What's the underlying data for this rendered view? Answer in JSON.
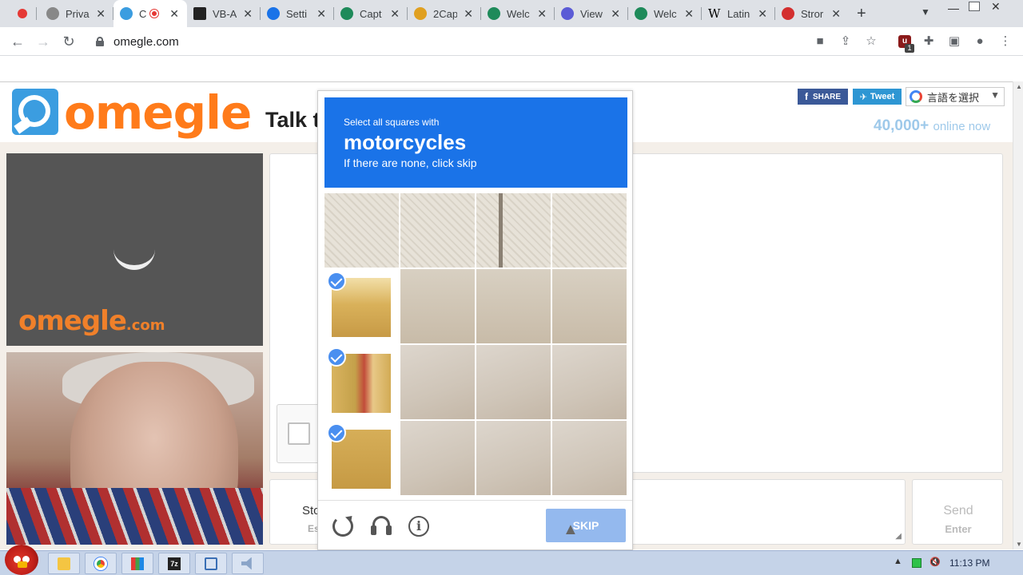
{
  "browser": {
    "tabs": [
      {
        "label": "",
        "icon": "record-icon",
        "color": "#e53935"
      },
      {
        "label": "Priva",
        "icon": "globe-icon",
        "color": "#5f6368"
      },
      {
        "label": "C",
        "icon": "omegle-favicon-icon",
        "color": "#3b9de0",
        "active": true
      },
      {
        "label": "VB-A",
        "icon": "vb-favicon-icon",
        "color": "#222222"
      },
      {
        "label": "Setti",
        "icon": "gear-icon",
        "color": "#1a73e8"
      },
      {
        "label": "Capt",
        "icon": "6-favicon-icon",
        "color": "#1e8a5a"
      },
      {
        "label": "2Cap",
        "icon": "2captcha-favicon-icon",
        "color": "#e0a020"
      },
      {
        "label": "Welc",
        "icon": "6-favicon-icon",
        "color": "#1e8a5a"
      },
      {
        "label": "View",
        "icon": "at-favicon-icon",
        "color": "#5b5bd6"
      },
      {
        "label": "Welc",
        "icon": "6-favicon-icon",
        "color": "#1e8a5a"
      },
      {
        "label": "Latin",
        "icon": "wikipedia-icon",
        "color": "#000000"
      },
      {
        "label": "Stror",
        "icon": "p-favicon-icon",
        "color": "#d32f2f"
      }
    ],
    "new_tab_label": "+",
    "tab_search_label": "⌄",
    "url": "omegle.com",
    "ext_badge_count": "1"
  },
  "page": {
    "logo_text": "omegle",
    "tagline": "Talk to strangers!",
    "share_fb": "SHARE",
    "share_tw": "Tweet",
    "translate_label": "言語を選択",
    "online_count": "40,000+",
    "online_label": "online now",
    "stranger_logo": "omegle",
    "stranger_logo_suffix": ".com",
    "stop_label": "Stop",
    "stop_key": "Esc",
    "send_label": "Send",
    "send_key": "Enter"
  },
  "captcha": {
    "prompt_small": "Select all squares with",
    "prompt_target": "motorcycles",
    "prompt_hint": "If there are none, click skip",
    "skip_label": "SKIP",
    "accent": "#1a73e8"
  },
  "taskbar": {
    "clock": "11:13 PM",
    "apps": [
      "folder-icon",
      "chrome-icon",
      "mixer-icon",
      "7zip-icon",
      "network-icon",
      "volume-app-icon"
    ]
  }
}
